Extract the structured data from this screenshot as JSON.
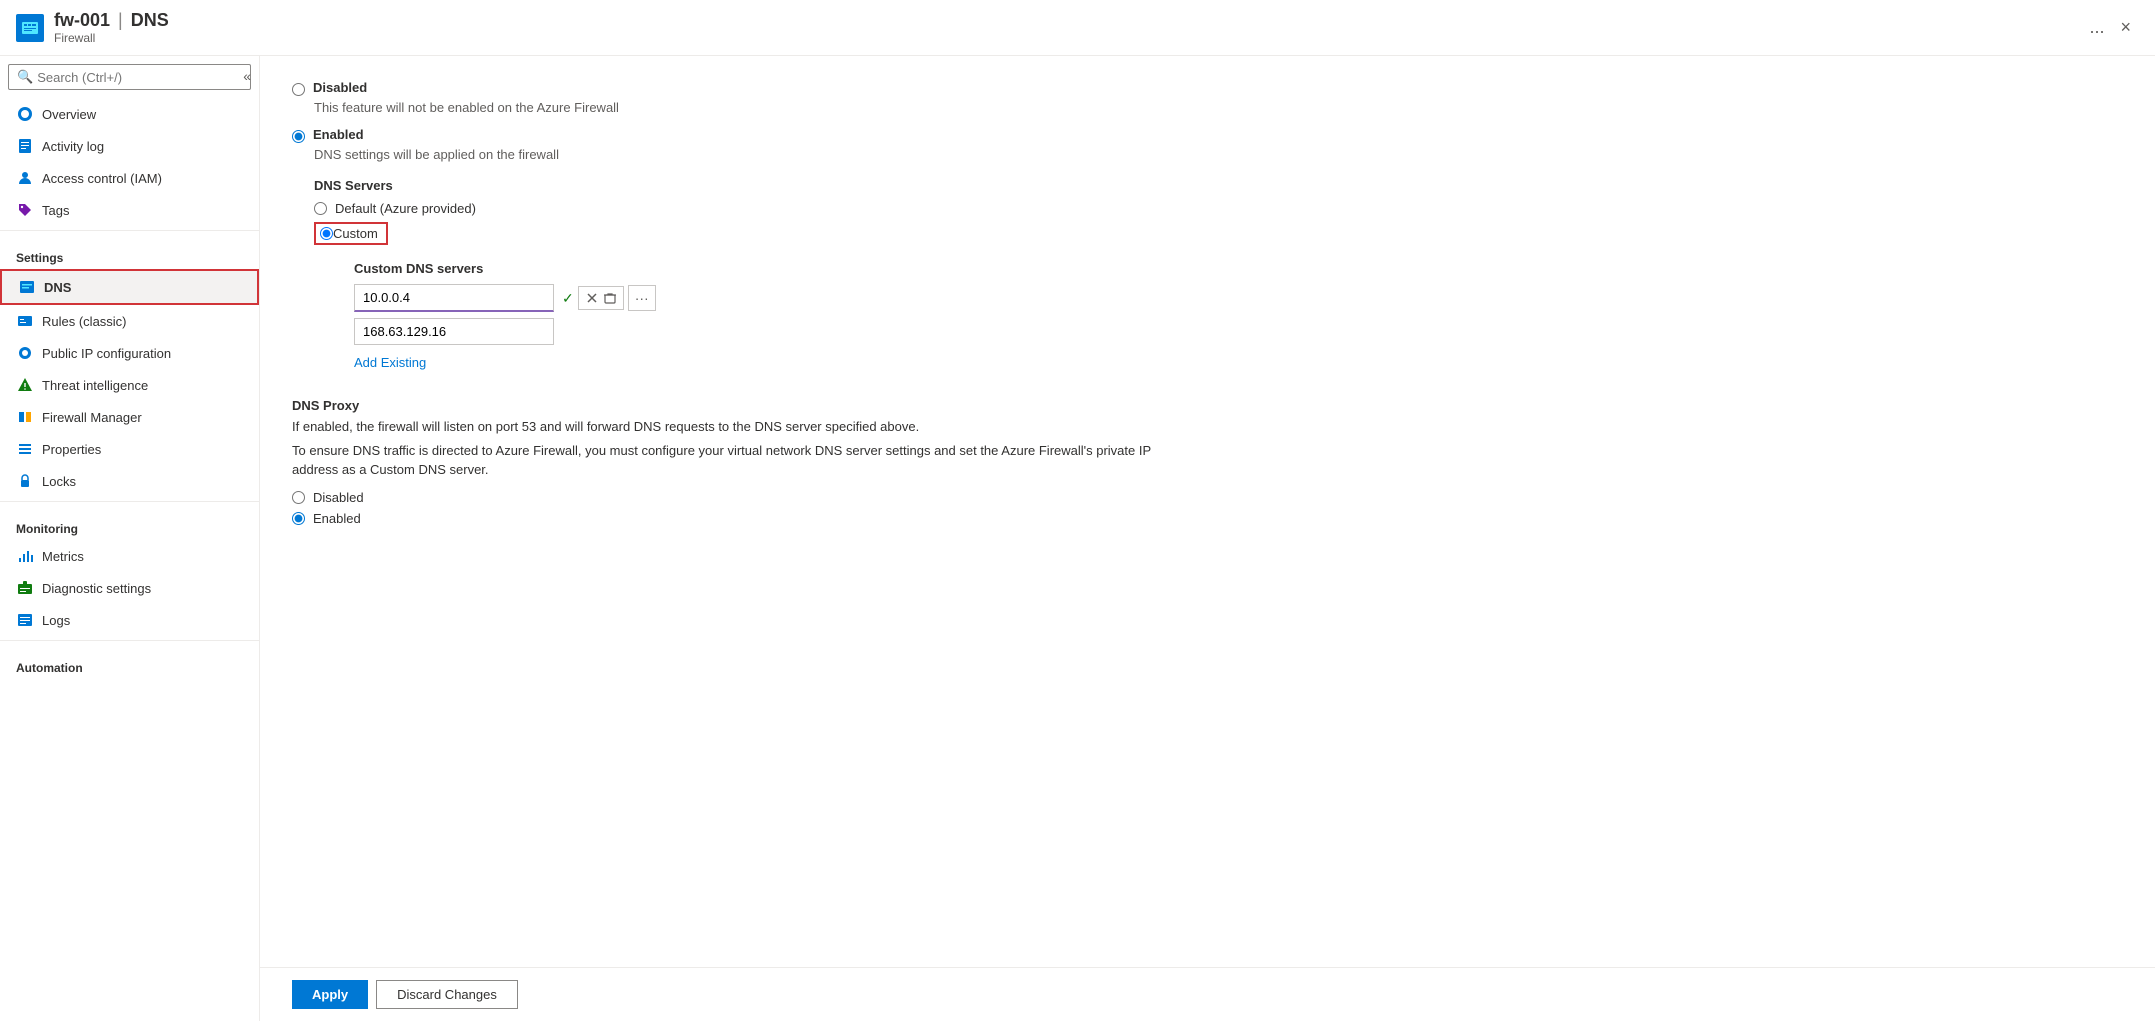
{
  "header": {
    "icon_label": "firewall-resource-icon",
    "title": "fw-001",
    "separator": "|",
    "page": "DNS",
    "subtitle": "Firewall",
    "ellipsis": "...",
    "close": "×"
  },
  "sidebar": {
    "search_placeholder": "Search (Ctrl+/)",
    "collapse_icon": "«",
    "nav_items": [
      {
        "id": "overview",
        "label": "Overview",
        "icon": "overview"
      },
      {
        "id": "activity-log",
        "label": "Activity log",
        "icon": "activity"
      },
      {
        "id": "access-control",
        "label": "Access control (IAM)",
        "icon": "iam"
      },
      {
        "id": "tags",
        "label": "Tags",
        "icon": "tags"
      }
    ],
    "settings_label": "Settings",
    "settings_items": [
      {
        "id": "dns",
        "label": "DNS",
        "icon": "dns",
        "active": true
      },
      {
        "id": "rules-classic",
        "label": "Rules (classic)",
        "icon": "rules"
      },
      {
        "id": "public-ip",
        "label": "Public IP configuration",
        "icon": "publicip"
      },
      {
        "id": "threat-intel",
        "label": "Threat intelligence",
        "icon": "threat"
      },
      {
        "id": "firewall-manager",
        "label": "Firewall Manager",
        "icon": "fwmanager"
      },
      {
        "id": "properties",
        "label": "Properties",
        "icon": "properties"
      },
      {
        "id": "locks",
        "label": "Locks",
        "icon": "locks"
      }
    ],
    "monitoring_label": "Monitoring",
    "monitoring_items": [
      {
        "id": "metrics",
        "label": "Metrics",
        "icon": "metrics"
      },
      {
        "id": "diagnostic",
        "label": "Diagnostic settings",
        "icon": "diagnostic"
      },
      {
        "id": "logs",
        "label": "Logs",
        "icon": "logs"
      }
    ],
    "automation_label": "Automation"
  },
  "content": {
    "disabled_label": "Disabled",
    "disabled_desc": "This feature will not be enabled on the Azure Firewall",
    "enabled_label": "Enabled",
    "enabled_desc": "DNS settings will be applied on the firewall",
    "dns_servers_label": "DNS Servers",
    "default_option": "Default (Azure provided)",
    "custom_option": "Custom",
    "custom_dns_servers_label": "Custom DNS servers",
    "dns_entry_1": "10.0.0.4",
    "dns_entry_2": "168.63.129.16",
    "add_existing_label": "Add Existing",
    "dns_proxy_title": "DNS Proxy",
    "dns_proxy_desc_1": "If enabled, the firewall will listen on port 53 and will forward DNS requests to the DNS server specified above.",
    "dns_proxy_desc_2": "To ensure DNS traffic is directed to Azure Firewall, you must configure your virtual network DNS server settings and set the Azure Firewall's private IP address as a Custom DNS server.",
    "proxy_disabled": "Disabled",
    "proxy_enabled": "Enabled"
  },
  "footer": {
    "apply_label": "Apply",
    "discard_label": "Discard Changes"
  }
}
